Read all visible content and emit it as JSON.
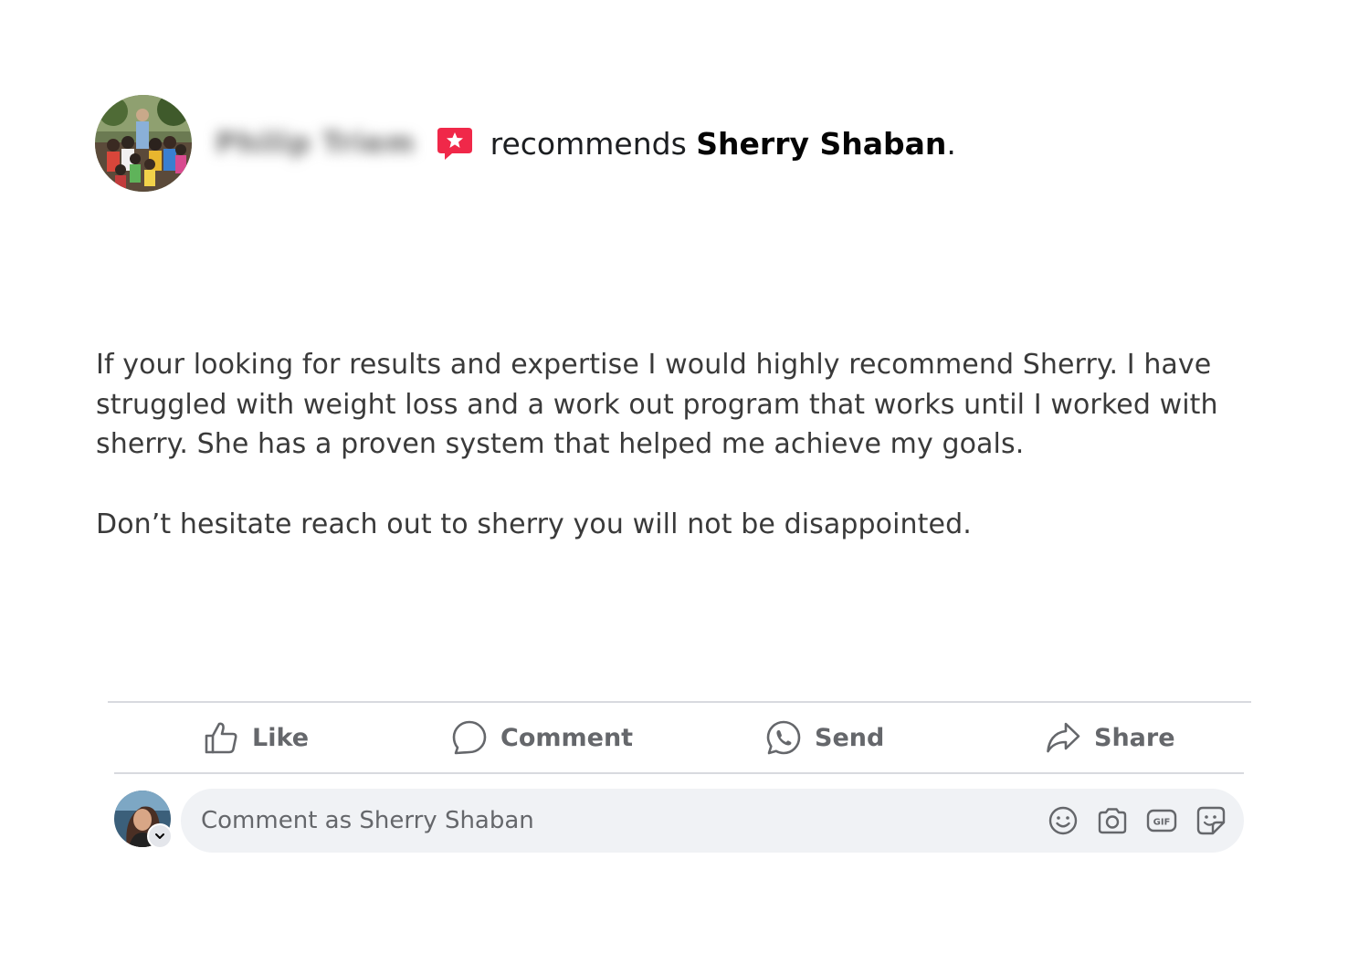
{
  "post": {
    "author": {
      "name": "Philip Triem",
      "name_blurred": true,
      "avatar": "group-photo-avatar"
    },
    "recommendation": {
      "icon": "recommend-star-icon",
      "icon_color": "#f02849",
      "verb": "recommends",
      "target": "Sherry Shaban",
      "period": "."
    },
    "body": {
      "paragraphs": [
        "If your looking for results and expertise I would highly recommend Sherry. I have struggled with weight loss and a work out program that works until I worked with sherry. She has a proven system that helped me achieve my goals.",
        "Don’t hesitate reach out to sherry you will not be disappointed."
      ]
    },
    "actions": {
      "like": {
        "label": "Like",
        "icon": "thumbs-up-icon"
      },
      "comment": {
        "label": "Comment",
        "icon": "speech-bubble-icon"
      },
      "send": {
        "label": "Send",
        "icon": "whatsapp-icon"
      },
      "share": {
        "label": "Share",
        "icon": "share-arrow-icon"
      }
    },
    "composer": {
      "placeholder": "Comment as Sherry Shaban",
      "value": "",
      "avatar": "user-profile-avatar",
      "tools": [
        "emoji-icon",
        "camera-icon",
        "gif-icon",
        "sticker-icon"
      ]
    }
  },
  "colors": {
    "action_text": "#65676b",
    "divider": "#d8dadf",
    "composer_bg": "#f0f2f5",
    "body_text": "#3a3a3a"
  }
}
